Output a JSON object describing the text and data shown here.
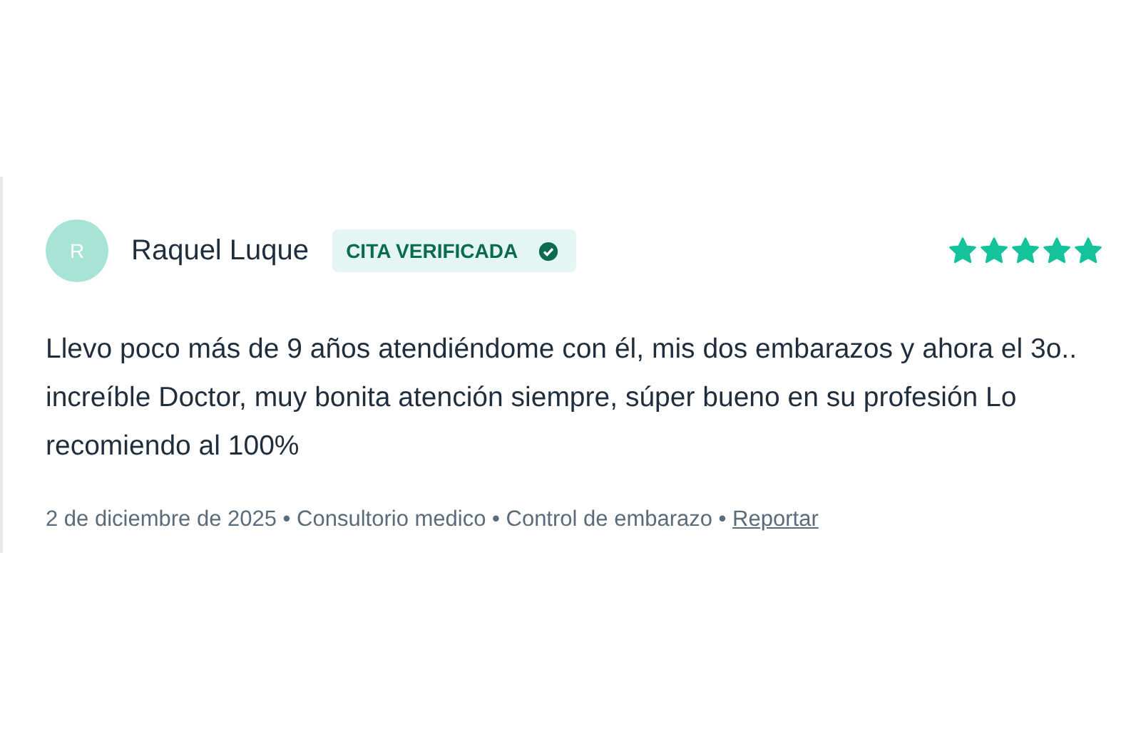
{
  "review": {
    "avatar_initial": "R",
    "author": "Raquel Luque",
    "badge": "CITA VERIFICADA",
    "verified": true,
    "stars": 5,
    "text": "Llevo poco más de 9 años atendiéndome con él, mis dos embarazos y ahora el 3o.. increíble Doctor, muy bonita atención siempre, súper bueno en su profesión Lo recomiendo al 100%",
    "meta": "2 de diciembre de 2025 • Consultorio medico • Control de embarazo •",
    "report_link": "Reportar"
  }
}
